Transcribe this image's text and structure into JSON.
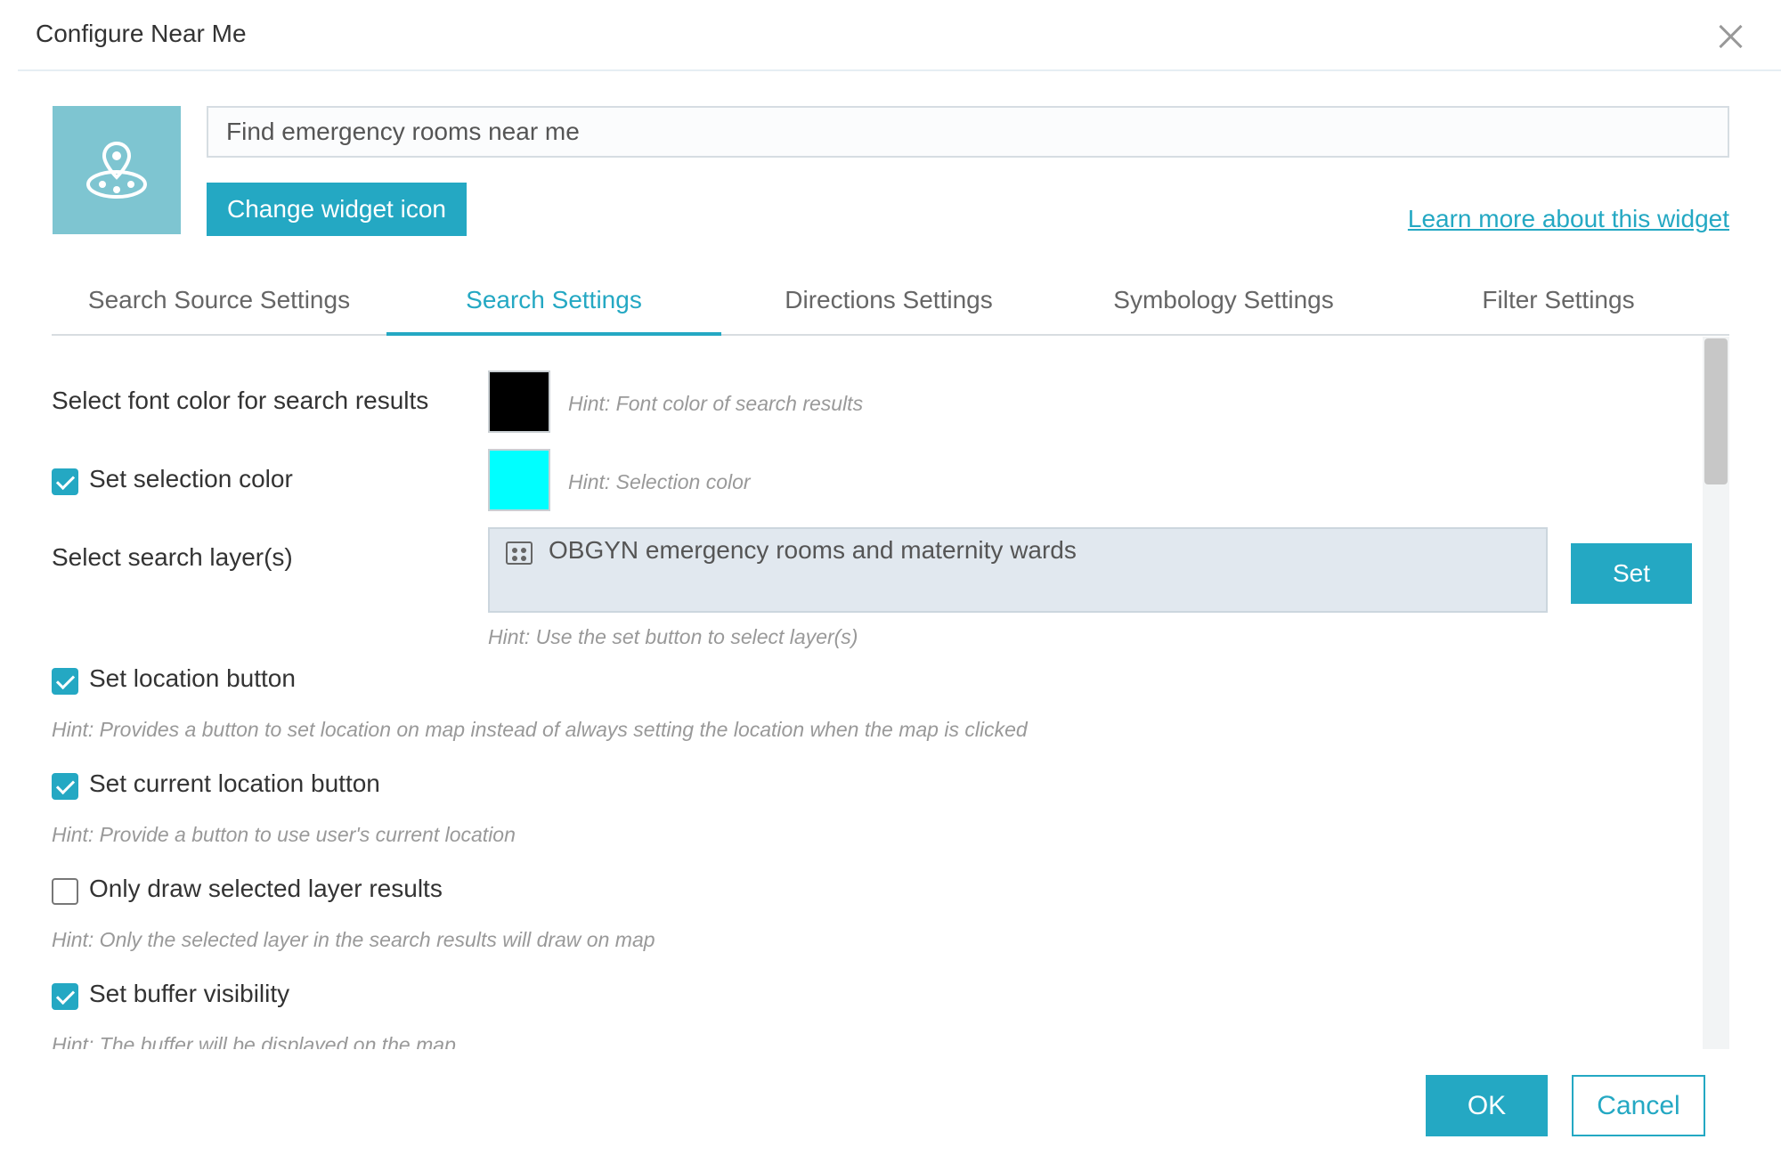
{
  "dialog": {
    "title": "Configure Near Me"
  },
  "widget": {
    "name_value": "Find emergency rooms near me",
    "change_icon_label": "Change widget icon",
    "learn_more_label": "Learn more about this widget",
    "icon": "map-pin-icon"
  },
  "tabs": [
    {
      "label": "Search Source Settings",
      "active": false
    },
    {
      "label": "Search Settings",
      "active": true
    },
    {
      "label": "Directions Settings",
      "active": false
    },
    {
      "label": "Symbology Settings",
      "active": false
    },
    {
      "label": "Filter Settings",
      "active": false
    }
  ],
  "search_settings": {
    "font_color": {
      "label": "Select font color for search results",
      "color": "#000000",
      "hint": "Hint: Font color of search results"
    },
    "selection_color": {
      "label": "Set selection color",
      "checked": true,
      "color": "#00ffff",
      "hint": "Hint: Selection color"
    },
    "search_layers": {
      "label": "Select search layer(s)",
      "value": "OBGYN emergency rooms and maternity wards",
      "set_label": "Set",
      "hint": "Hint: Use the set button to select layer(s)"
    },
    "location_button": {
      "label": "Set location button",
      "checked": true,
      "hint": "Hint: Provides a button to set location on map instead of always setting the location when the map is clicked"
    },
    "current_location_button": {
      "label": "Set current location button",
      "checked": true,
      "hint": "Hint: Provide a button to use user's current location"
    },
    "only_draw_selected": {
      "label": "Only draw selected layer results",
      "checked": false,
      "hint": "Hint: Only the selected layer in the search results will draw on map"
    },
    "buffer_visibility": {
      "label": "Set buffer visibility",
      "checked": true,
      "hint": "Hint: The buffer will be displayed on the map"
    }
  },
  "footer": {
    "ok_label": "OK",
    "cancel_label": "Cancel"
  },
  "colors": {
    "accent": "#24a8c3",
    "icon_bg": "#7ec5d1"
  }
}
